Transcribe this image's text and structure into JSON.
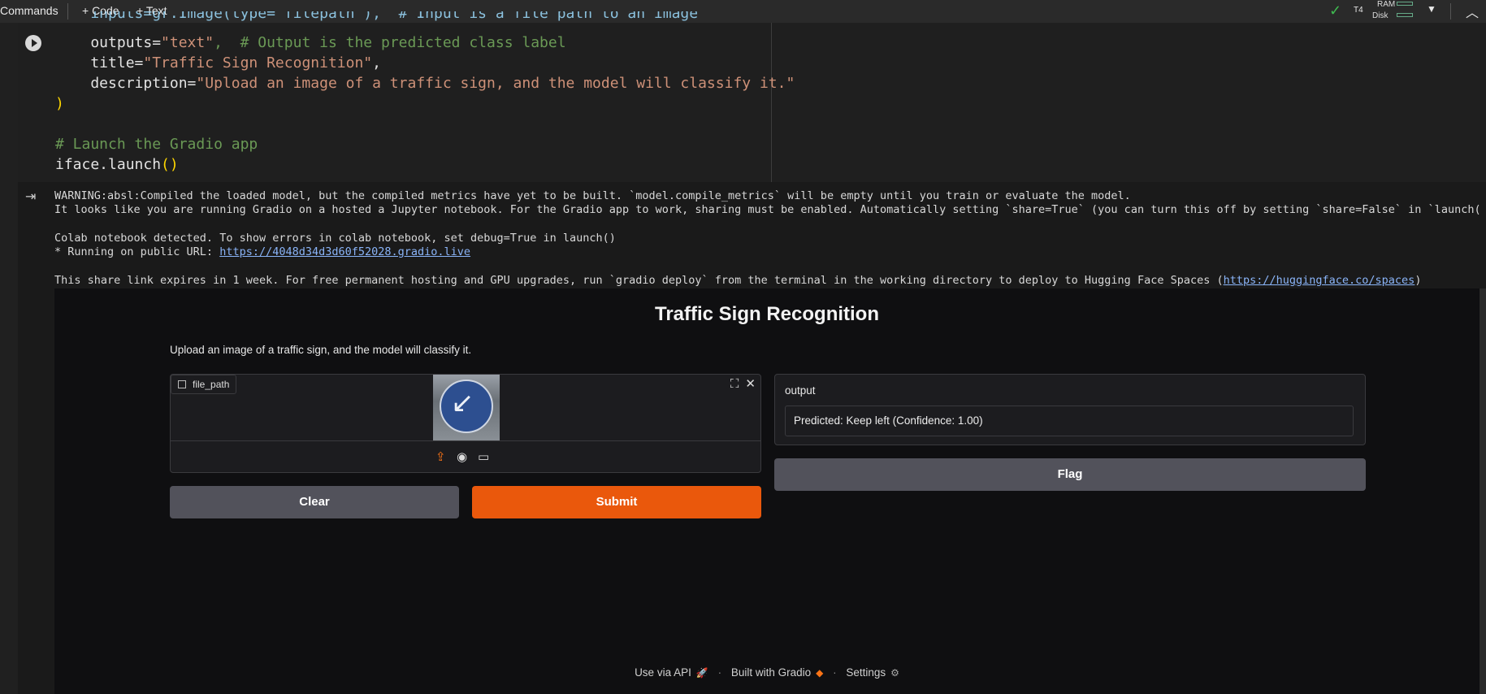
{
  "toolbar": {
    "commands": "Commands",
    "code": "+ Code",
    "text": "+ Text",
    "runtime": "T4",
    "ram": "RAM",
    "disk": "Disk"
  },
  "code": {
    "line0": "    inputs=gr.Image(type=\"filepath\"),  # Input is a file path to an image",
    "line1_key": "    outputs=",
    "line1_val": "\"text\"",
    "line1_comment": ",  # Output is the predicted class label",
    "line2_key": "    title=",
    "line2_val": "\"Traffic Sign Recognition\"",
    "line2_end": ",",
    "line3_key": "    description=",
    "line3_val": "\"Upload an image of a traffic sign, and the model will classify it.\"",
    "line4": ")",
    "line6": "# Launch the Gradio app",
    "line7_obj": "iface.launch",
    "line7_paren": "()"
  },
  "output": {
    "warning": "WARNING:absl:Compiled the loaded model, but the compiled metrics have yet to be built. `model.compile_metrics` will be empty until you train or evaluate the model.",
    "share_note": "It looks like you are running Gradio on a hosted a Jupyter notebook. For the Gradio app to work, sharing must be enabled. Automatically setting `share=True` (you can turn this off by setting `share=False` in `launch()` explicitl",
    "colab_note": "Colab notebook detected. To show errors in colab notebook, set debug=True in launch()",
    "running_prefix": "* Running on public URL: ",
    "public_url": "https://4048d34d3d60f52028.gradio.live",
    "expires_prefix": "This share link expires in 1 week. For free permanent hosting and GPU upgrades, run `gradio deploy` from the terminal in the working directory to deploy to Hugging Face Spaces (",
    "spaces_url": "https://huggingface.co/spaces",
    "expires_suffix": ")"
  },
  "gradio": {
    "title": "Traffic Sign Recognition",
    "description": "Upload an image of a traffic sign, and the model will classify it.",
    "input_label": "file_path",
    "output_label": "output",
    "output_value": "Predicted: Keep left (Confidence: 1.00)",
    "flag": "Flag",
    "clear": "Clear",
    "submit": "Submit",
    "footer_api": "Use via API",
    "footer_built": "Built with Gradio",
    "footer_settings": "Settings"
  },
  "colors": {
    "accent_orange": "#ea580c",
    "string": "#ce9178",
    "comment": "#6a9955",
    "paren": "#ffd700"
  }
}
